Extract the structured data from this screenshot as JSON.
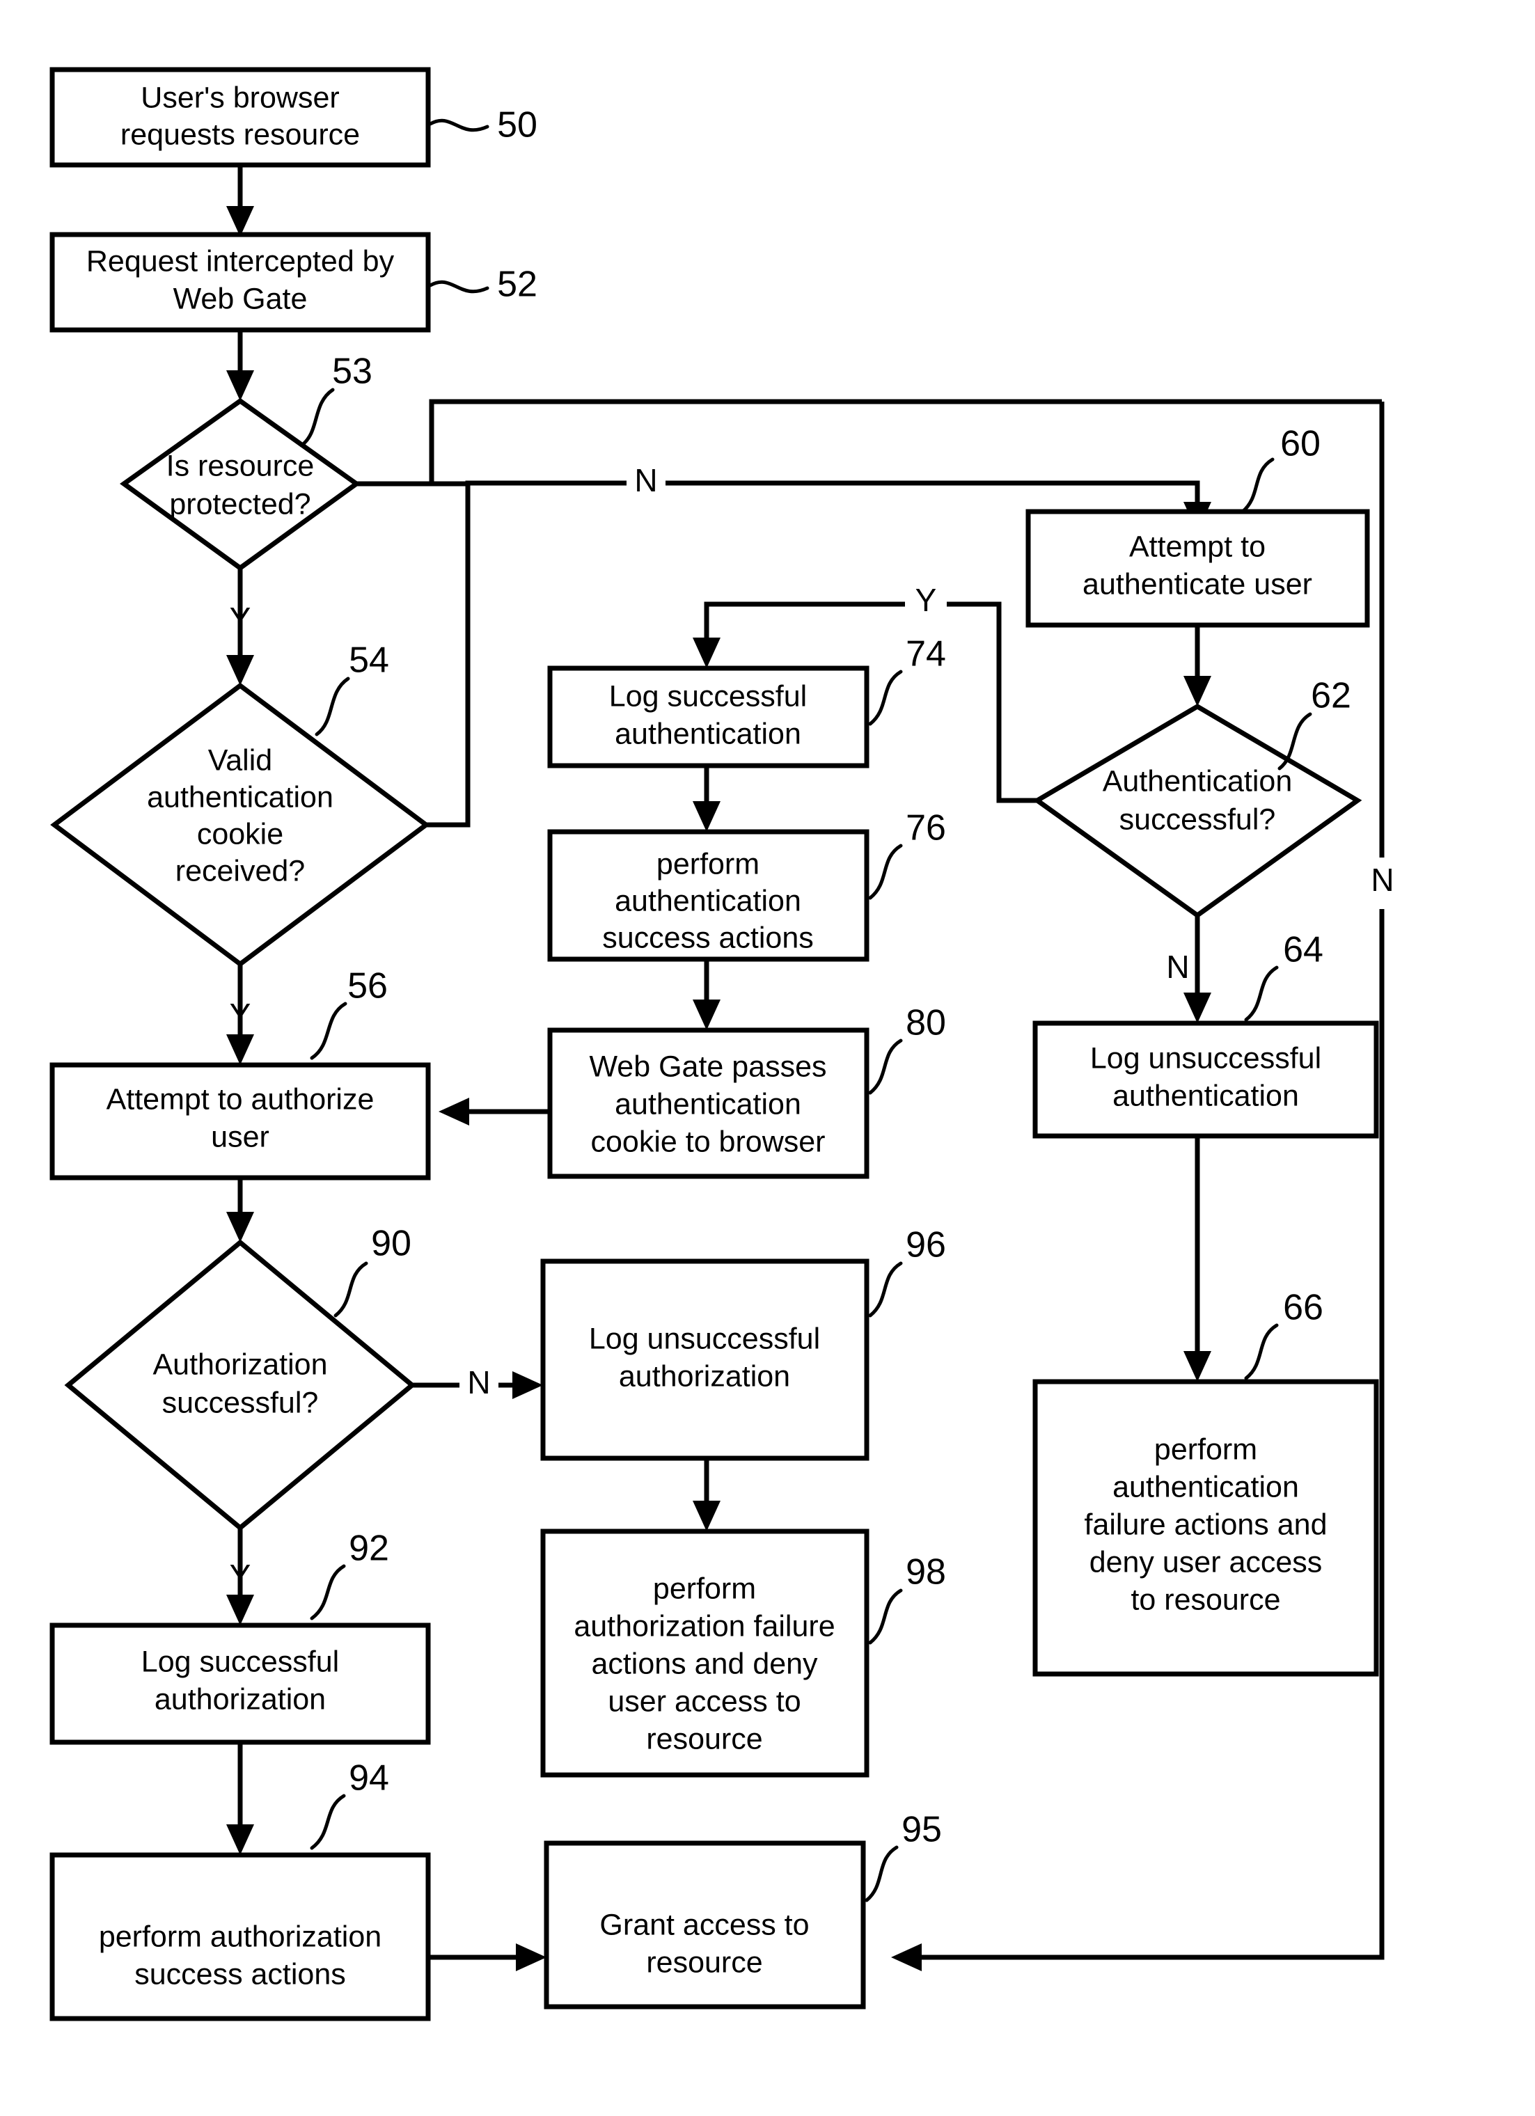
{
  "diagram": {
    "type": "flowchart",
    "title": "",
    "nodes": [
      {
        "id": "50",
        "shape": "process",
        "ref": "50",
        "lines": [
          "User's browser",
          "requests resource"
        ]
      },
      {
        "id": "52",
        "shape": "process",
        "ref": "52",
        "lines": [
          "Request intercepted by",
          "Web Gate"
        ]
      },
      {
        "id": "53",
        "shape": "decision",
        "ref": "53",
        "lines": [
          "Is resource",
          "protected?"
        ]
      },
      {
        "id": "54",
        "shape": "decision",
        "ref": "54",
        "lines": [
          "Valid",
          "authentication",
          "cookie",
          "received?"
        ]
      },
      {
        "id": "56",
        "shape": "process",
        "ref": "56",
        "lines": [
          "Attempt to authorize",
          "user"
        ]
      },
      {
        "id": "60",
        "shape": "process",
        "ref": "60",
        "lines": [
          "Attempt to",
          "authenticate user"
        ]
      },
      {
        "id": "62",
        "shape": "decision",
        "ref": "62",
        "lines": [
          "Authentication",
          "successful?"
        ]
      },
      {
        "id": "64",
        "shape": "process",
        "ref": "64",
        "lines": [
          "Log unsuccessful",
          "authentication"
        ]
      },
      {
        "id": "66",
        "shape": "process",
        "ref": "66",
        "lines": [
          "perform",
          "authentication",
          "failure actions and",
          "deny user access",
          "to resource"
        ]
      },
      {
        "id": "74",
        "shape": "process",
        "ref": "74",
        "lines": [
          "Log successful",
          "authentication"
        ]
      },
      {
        "id": "76",
        "shape": "process",
        "ref": "76",
        "lines": [
          "perform",
          "authentication",
          "success actions"
        ]
      },
      {
        "id": "80",
        "shape": "process",
        "ref": "80",
        "lines": [
          "Web Gate passes",
          "authentication",
          "cookie to browser"
        ]
      },
      {
        "id": "90",
        "shape": "decision",
        "ref": "90",
        "lines": [
          "Authorization",
          "successful?"
        ]
      },
      {
        "id": "92",
        "shape": "process",
        "ref": "92",
        "lines": [
          "Log successful",
          "authorization"
        ]
      },
      {
        "id": "94",
        "shape": "process",
        "ref": "94",
        "lines": [
          "perform authorization",
          "success actions"
        ]
      },
      {
        "id": "95",
        "shape": "process",
        "ref": "95",
        "lines": [
          "Grant access to",
          "resource"
        ]
      },
      {
        "id": "96",
        "shape": "process",
        "ref": "96",
        "lines": [
          "Log unsuccessful",
          "authorization"
        ]
      },
      {
        "id": "98",
        "shape": "process",
        "ref": "98",
        "lines": [
          "perform",
          "authorization failure",
          "actions and deny",
          "user access  to",
          "resource"
        ]
      }
    ],
    "branch_labels": {
      "protected_no": "N",
      "protected_yes": "Y",
      "cookie_yes": "Y",
      "auth_yes": "Y",
      "auth_no": "N",
      "authz_yes": "Y",
      "authz_no": "N",
      "bypass_no": "N"
    },
    "colors": {
      "stroke": "#000000",
      "fill": "#ffffff",
      "text": "#000000"
    }
  }
}
